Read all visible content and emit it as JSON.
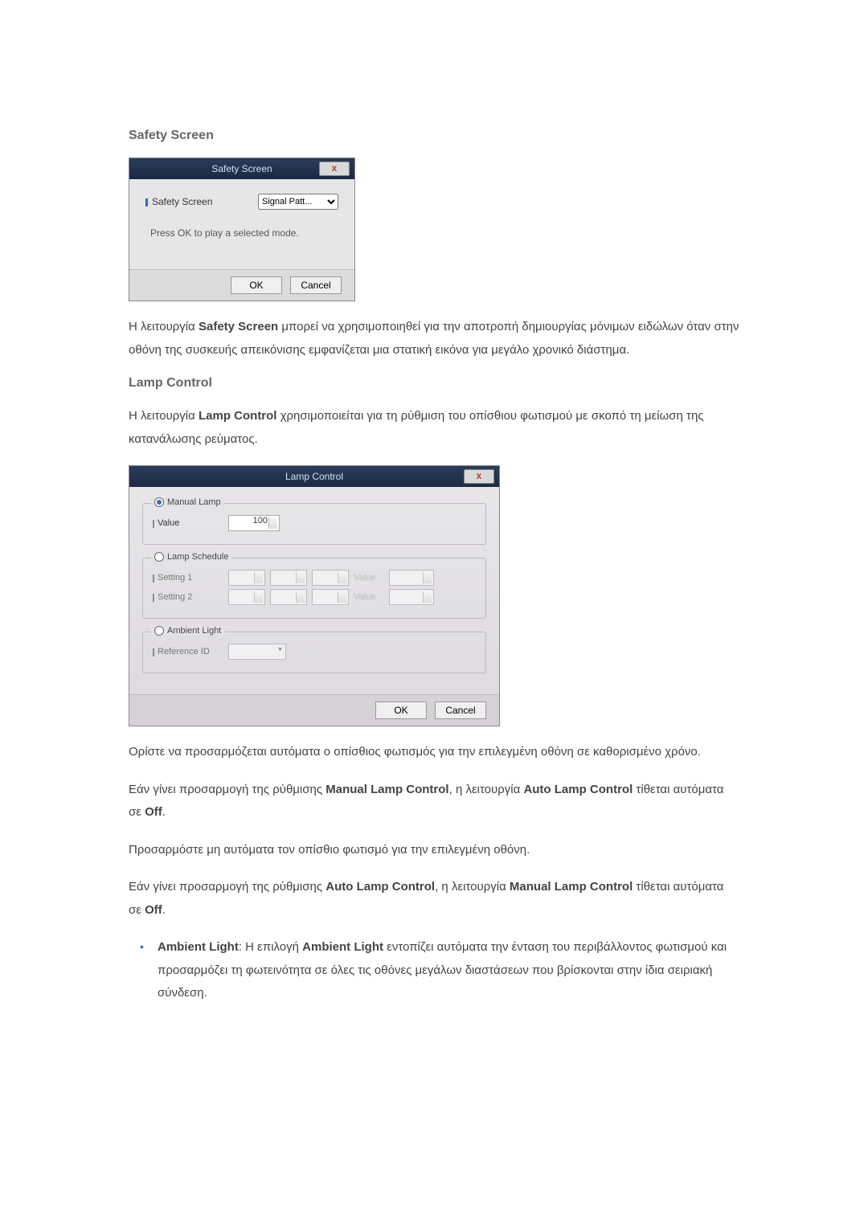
{
  "section1": {
    "heading": "Safety Screen",
    "dialog": {
      "title": "Safety Screen",
      "close": "x",
      "field_label": "Safety Screen",
      "field_value": "Signal Patt...",
      "message": "Press OK to play a selected mode.",
      "ok": "OK",
      "cancel": "Cancel"
    },
    "para_parts": {
      "p1a": "Η λειτουργία ",
      "p1b": "Safety Screen",
      "p1c": " μπορεί να χρησιμοποιηθεί για την αποτροπή δημιουργίας μόνιμων ειδώλων όταν στην οθόνη της συσκευής απεικόνισης εμφανίζεται μια στατική εικόνα για μεγάλο χρονικό διάστημα."
    }
  },
  "section2": {
    "heading": "Lamp Control",
    "intro": {
      "a": "Η λειτουργία ",
      "b": "Lamp Control",
      "c": " χρησιμοποιείται για τη ρύθμιση του οπίσθιου φωτισμού με σκοπό τη μείωση της κατανάλωσης ρεύματος."
    },
    "dialog": {
      "title": "Lamp Control",
      "close": "x",
      "manual_legend": "Manual Lamp",
      "value_label": "Value",
      "value": "100",
      "schedule_legend": "Lamp Schedule",
      "setting1": "Setting 1",
      "setting2": "Setting 2",
      "value_text": "Value",
      "ambient_legend": "Ambient Light",
      "ref_label": "Reference ID",
      "ok": "OK",
      "cancel": "Cancel"
    },
    "p2": "Ορίστε να προσαρμόζεται αυτόματα ο οπίσθιος φωτισμός για την επιλεγμένη οθόνη σε καθορισμένο χρόνο.",
    "p3": {
      "a": "Εάν γίνει προσαρμογή της ρύθμισης ",
      "b": "Manual Lamp Control",
      "c": ", η λειτουργία ",
      "d": "Auto Lamp Control",
      "e": " τίθεται αυτόματα σε ",
      "f": "Off",
      "g": "."
    },
    "p4": "Προσαρμόστε μη αυτόματα τον οπίσθιο φωτισμό για την επιλεγμένη οθόνη.",
    "p5": {
      "a": "Εάν γίνει προσαρμογή της ρύθμισης ",
      "b": "Auto Lamp Control",
      "c": ", η λειτουργία ",
      "d": "Manual Lamp Control",
      "e": " τίθεται αυτόματα σε ",
      "f": "Off",
      "g": "."
    },
    "bullet": {
      "a": "Ambient Light",
      "b": ": Η επιλογή ",
      "c": "Ambient Light",
      "d": " εντοπίζει αυτόματα την ένταση του περιβάλλοντος φωτισμού και προσαρμόζει τη φωτεινότητα σε όλες τις οθόνες μεγάλων διαστάσεων που βρίσκονται στην ίδια σειριακή σύνδεση."
    }
  }
}
